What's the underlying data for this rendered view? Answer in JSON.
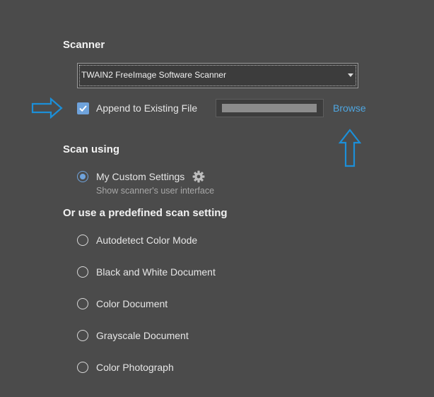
{
  "scanner": {
    "heading": "Scanner",
    "selected_scanner": "TWAIN2 FreeImage Software Scanner",
    "append_label": "Append to Existing File",
    "append_checked": true,
    "file_path": "",
    "browse_label": "Browse"
  },
  "scan_using": {
    "heading": "Scan using",
    "custom_label": "My Custom Settings",
    "custom_sublabel": "Show scanner's user interface",
    "custom_selected": true
  },
  "predefined": {
    "heading": "Or use a predefined scan setting",
    "options": [
      {
        "label": "Autodetect Color Mode",
        "selected": false
      },
      {
        "label": "Black and White Document",
        "selected": false
      },
      {
        "label": "Color Document",
        "selected": false
      },
      {
        "label": "Grayscale Document",
        "selected": false
      },
      {
        "label": "Color Photograph",
        "selected": false
      }
    ]
  },
  "annotation": {
    "arrow_color": "#1c8fd8",
    "icons": [
      "arrow-right-outline-icon",
      "arrow-up-outline-icon"
    ]
  },
  "colors": {
    "background": "#4b4b4b",
    "accent": "#6fa3dc",
    "link": "#4fa6e0"
  }
}
